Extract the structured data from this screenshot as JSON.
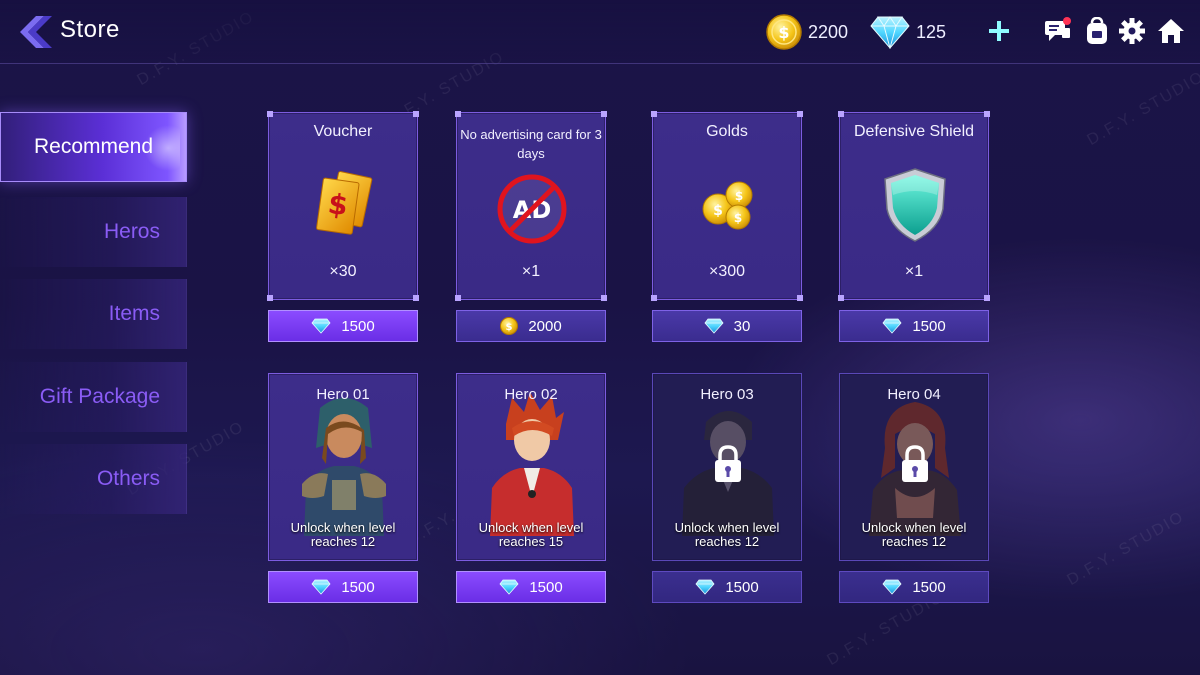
{
  "header": {
    "title": "Store",
    "gold_amount": "2200",
    "gem_amount": "125"
  },
  "sidebar": {
    "tabs": [
      {
        "label": "Recommend",
        "active": true
      },
      {
        "label": "Heros",
        "active": false
      },
      {
        "label": "Items",
        "active": false
      },
      {
        "label": "Gift Package",
        "active": false
      },
      {
        "label": "Others",
        "active": false
      }
    ]
  },
  "items": [
    {
      "name": "Voucher",
      "quantity": "×30",
      "price": "1500",
      "currency": "gem",
      "icon": "voucher-icon"
    },
    {
      "name": "No advertising card for 3 days",
      "quantity": "×1",
      "price": "2000",
      "currency": "gold",
      "icon": "no-ad-icon",
      "ad_text": "AD"
    },
    {
      "name": "Golds",
      "quantity": "×300",
      "price": "30",
      "currency": "gem",
      "icon": "coin-stack-icon"
    },
    {
      "name": "Defensive Shield",
      "quantity": "×1",
      "price": "1500",
      "currency": "gem",
      "icon": "shield-icon"
    }
  ],
  "heroes": [
    {
      "name": "Hero 01",
      "unlock": "Unlock when level reaches 12",
      "price": "1500",
      "currency": "gem",
      "locked": false
    },
    {
      "name": "Hero 02",
      "unlock": "Unlock when level reaches 15",
      "price": "1500",
      "currency": "gem",
      "locked": false
    },
    {
      "name": "Hero 03",
      "unlock": "Unlock when level reaches 12",
      "price": "1500",
      "currency": "gem",
      "locked": true
    },
    {
      "name": "Hero 04",
      "unlock": "Unlock when level reaches 12",
      "price": "1500",
      "currency": "gem",
      "locked": true
    }
  ],
  "watermark": "D.F.Y. STUDIO",
  "colors": {
    "accent": "#7c4dff",
    "gold": "#f5c518",
    "gem": "#4fd6ff",
    "tab_inactive": "#8a5cf5"
  }
}
